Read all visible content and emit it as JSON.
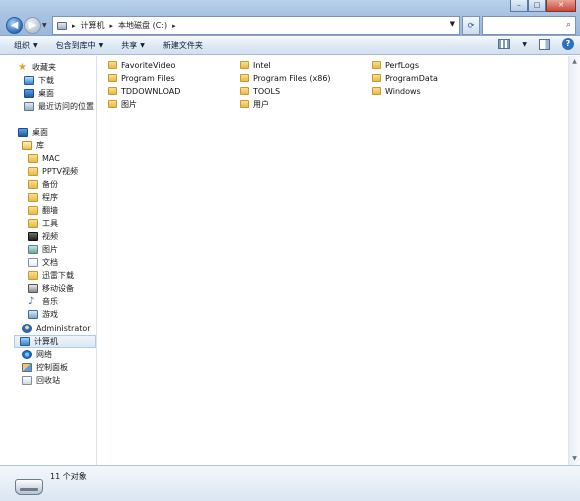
{
  "window": {
    "caption_buttons": [
      "minimize",
      "maximize",
      "close"
    ]
  },
  "address": {
    "crumbs": [
      "计算机",
      "本地磁盘 (C:)"
    ]
  },
  "toolbar": {
    "organize": "组织",
    "include_in_library": "包含到库中",
    "share": "共享",
    "new_folder": "新建文件夹"
  },
  "navpane": {
    "favorites": "收藏夹",
    "downloads": "下载",
    "desktop_fav": "桌面",
    "recent": "最近访问的位置",
    "desktop": "桌面",
    "libraries": "库",
    "library_items": [
      "MAC",
      "PPTV视频",
      "备份",
      "程序",
      "翻墙",
      "工具",
      "视频",
      "图片",
      "文档",
      "迅雷下载",
      "移动设备",
      "音乐",
      "游戏"
    ],
    "administrator": "Administrator",
    "computer": "计算机",
    "network": "网络",
    "control_panel": "控制面板",
    "recycle_bin": "回收站"
  },
  "content": {
    "items": [
      "FavoriteVideo",
      "Intel",
      "PerfLogs",
      "Program Files",
      "Program Files (x86)",
      "ProgramData",
      "TDDOWNLOAD",
      "TOOLS",
      "Windows",
      "图片",
      "用户"
    ]
  },
  "status": {
    "count_text": "11 个对象"
  }
}
